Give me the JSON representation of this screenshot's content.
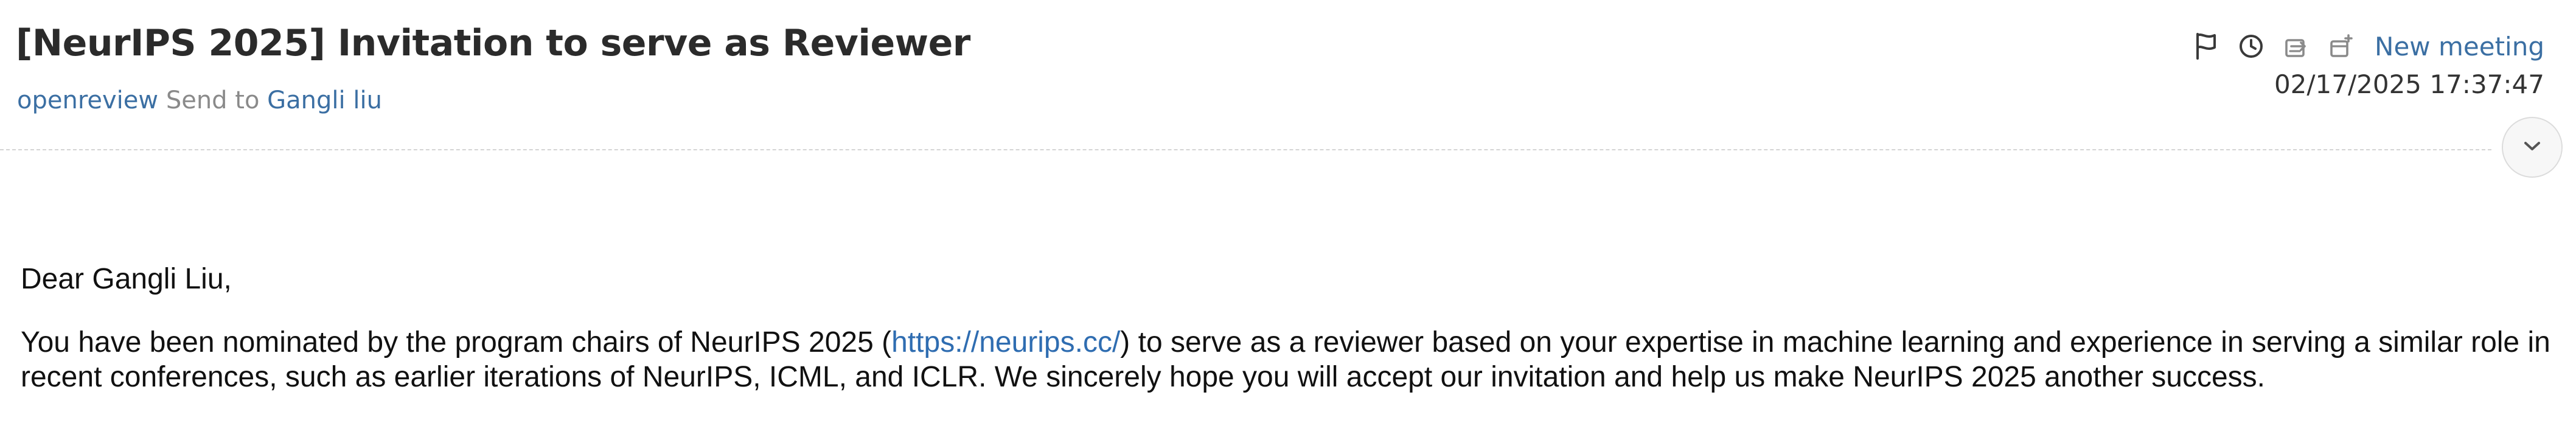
{
  "email": {
    "subject": "[NeurIPS 2025] Invitation to serve as Reviewer",
    "sender": "openreview",
    "send_to_label": "Send to",
    "recipient": "Gangli liu",
    "timestamp": "02/17/2025 17:37:47"
  },
  "toolbar": {
    "icons": [
      "flag-icon",
      "clock-icon",
      "forward-icon",
      "meeting-icon",
      "chevron-down-icon"
    ],
    "new_meeting_label": "New meeting"
  },
  "body": {
    "greeting": "Dear Gangli Liu,",
    "para1_before_link": "You have been nominated by the program chairs of NeurIPS 2025 (",
    "para1_link": "https://neurips.cc/",
    "para1_after_link": ") to serve as a reviewer based on your expertise in machine learning and experience in serving a similar role in recent conferences, such as earlier iterations of NeurIPS, ICML, and ICLR. We sincerely hope you will accept our invitation and help us make NeurIPS 2025 another success."
  },
  "colors": {
    "link": "#3b6fa3",
    "body_link": "#2f6db1",
    "muted": "#8a8a8a",
    "divider": "#d4d4d4"
  }
}
